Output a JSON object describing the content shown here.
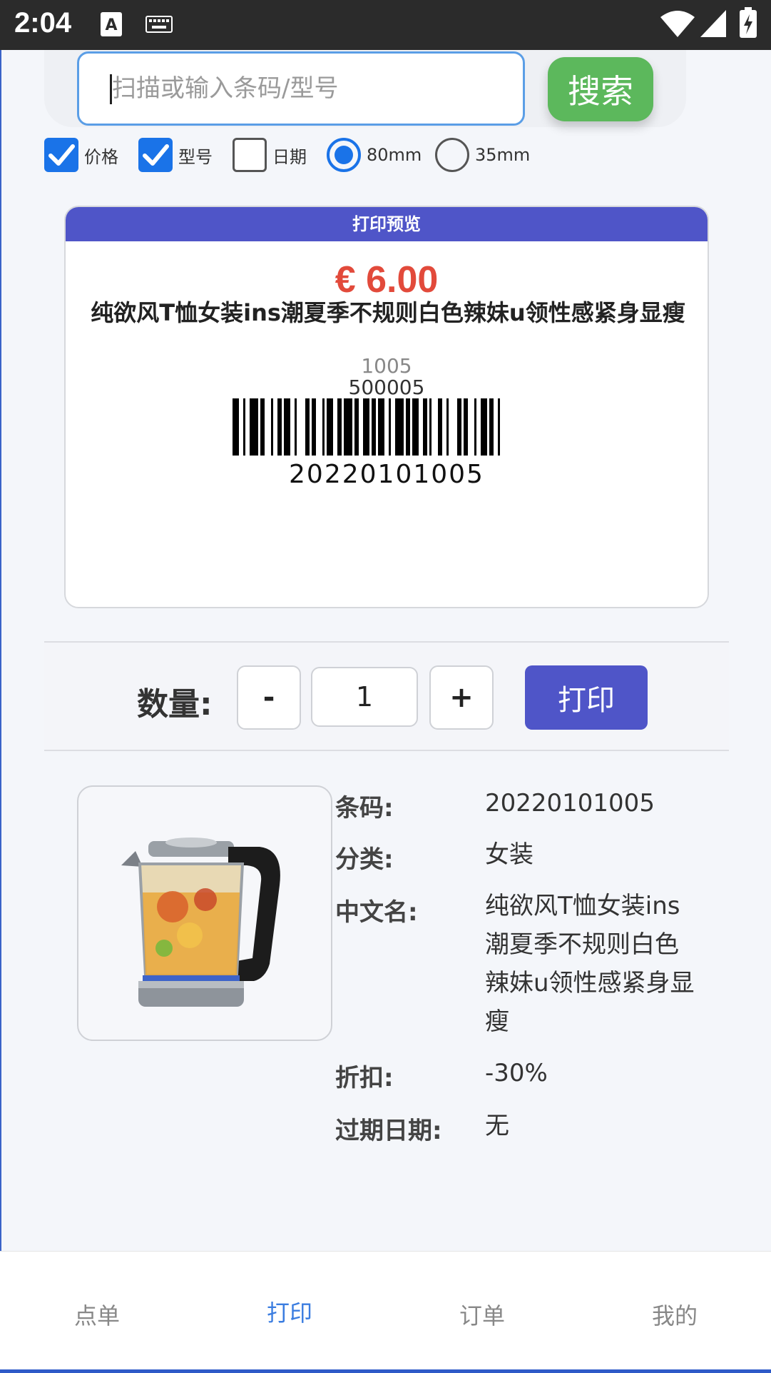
{
  "status_bar": {
    "time": "2:04"
  },
  "search": {
    "placeholder": "扫描或输入条码/型号",
    "button_label": "搜索"
  },
  "options": {
    "price": {
      "label": "价格",
      "checked": true
    },
    "model": {
      "label": "型号",
      "checked": true
    },
    "date": {
      "label": "日期",
      "checked": false
    },
    "size_80": {
      "label": "80mm",
      "selected": true
    },
    "size_35": {
      "label": "35mm",
      "selected": false
    }
  },
  "preview": {
    "header": "打印预览",
    "price": "€ 6.00",
    "name": "纯欲风T恤女装ins潮夏季不规则白色辣妹u领性感紧身显瘦",
    "model": "1005",
    "code": "500005",
    "barcode_number": "20220101005"
  },
  "quantity": {
    "label": "数量:",
    "minus": "-",
    "value": "1",
    "plus": "+",
    "print_label": "打印"
  },
  "details": {
    "barcode": {
      "label": "条码:",
      "value": "20220101005"
    },
    "category": {
      "label": "分类:",
      "value": "女装"
    },
    "cn_name": {
      "label": "中文名:",
      "value": "纯欲风T恤女装ins潮夏季不规则白色辣妹u领性感紧身显瘦"
    },
    "discount": {
      "label": "折扣:",
      "value": "-30%"
    },
    "expiry": {
      "label": "过期日期:",
      "value": "无"
    }
  },
  "nav": {
    "items": [
      {
        "label": "点单",
        "active": false
      },
      {
        "label": "打印",
        "active": true
      },
      {
        "label": "订单",
        "active": false
      },
      {
        "label": "我的",
        "active": false
      }
    ]
  },
  "colors": {
    "accent": "#4f55c8",
    "search_green": "#5cb85c",
    "checkbox_blue": "#1a73e8",
    "price_red": "#e24a3b",
    "nav_active": "#3b7de0"
  }
}
